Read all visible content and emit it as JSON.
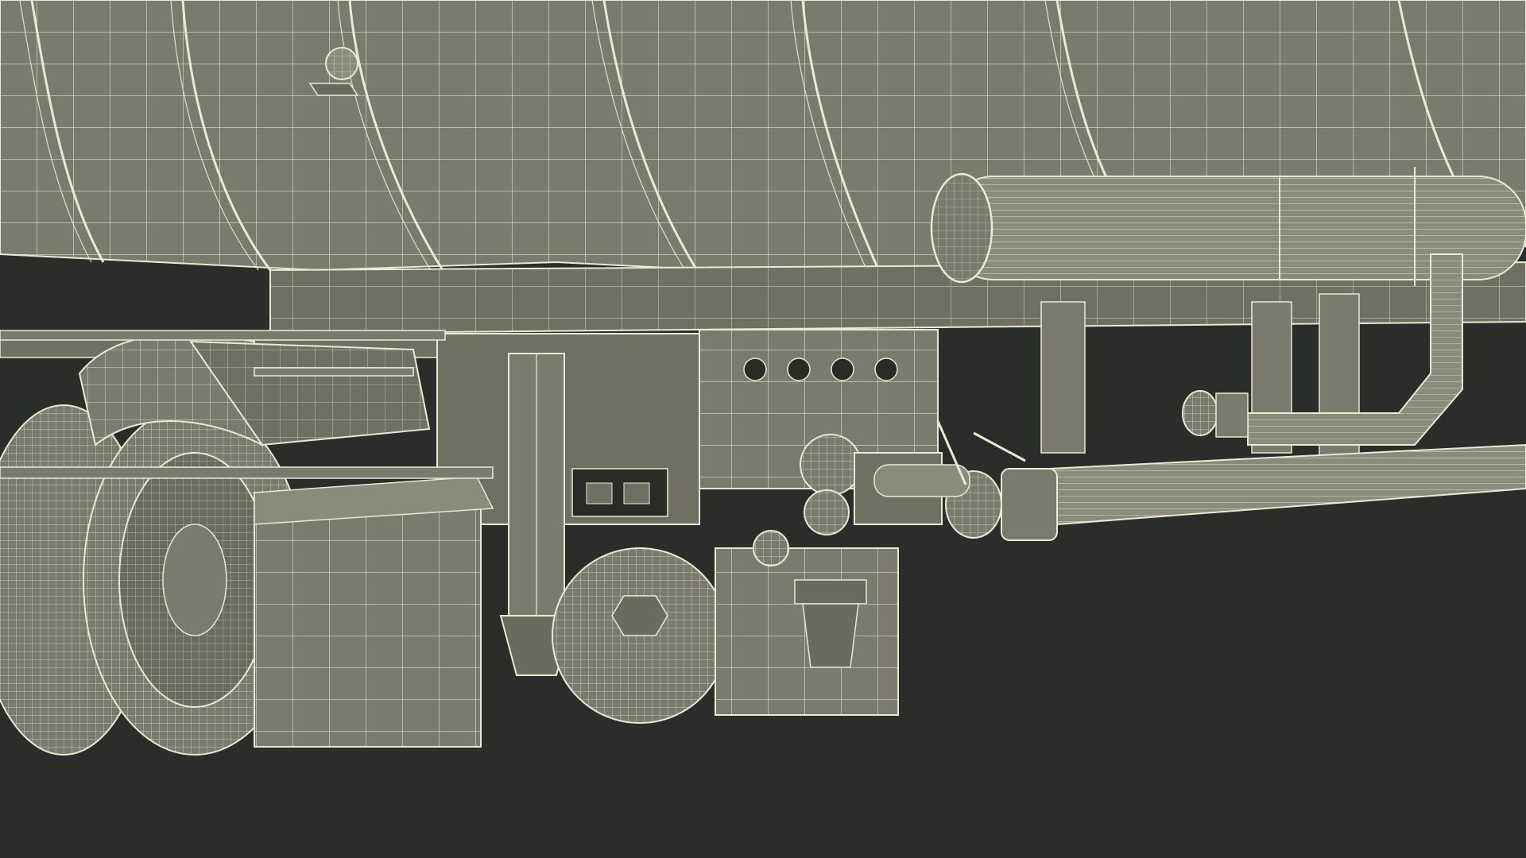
{
  "scene": {
    "subject": "wireframe-render-tanker-trailer-undercarriage",
    "colors": {
      "background": "#2b2d2b",
      "surface": "#7a7b6c",
      "surface_dark": "#6a6b5d",
      "surface_light": "#8a8b7b",
      "wire": "#e9e9d4",
      "hole": "#2a2b27"
    }
  }
}
